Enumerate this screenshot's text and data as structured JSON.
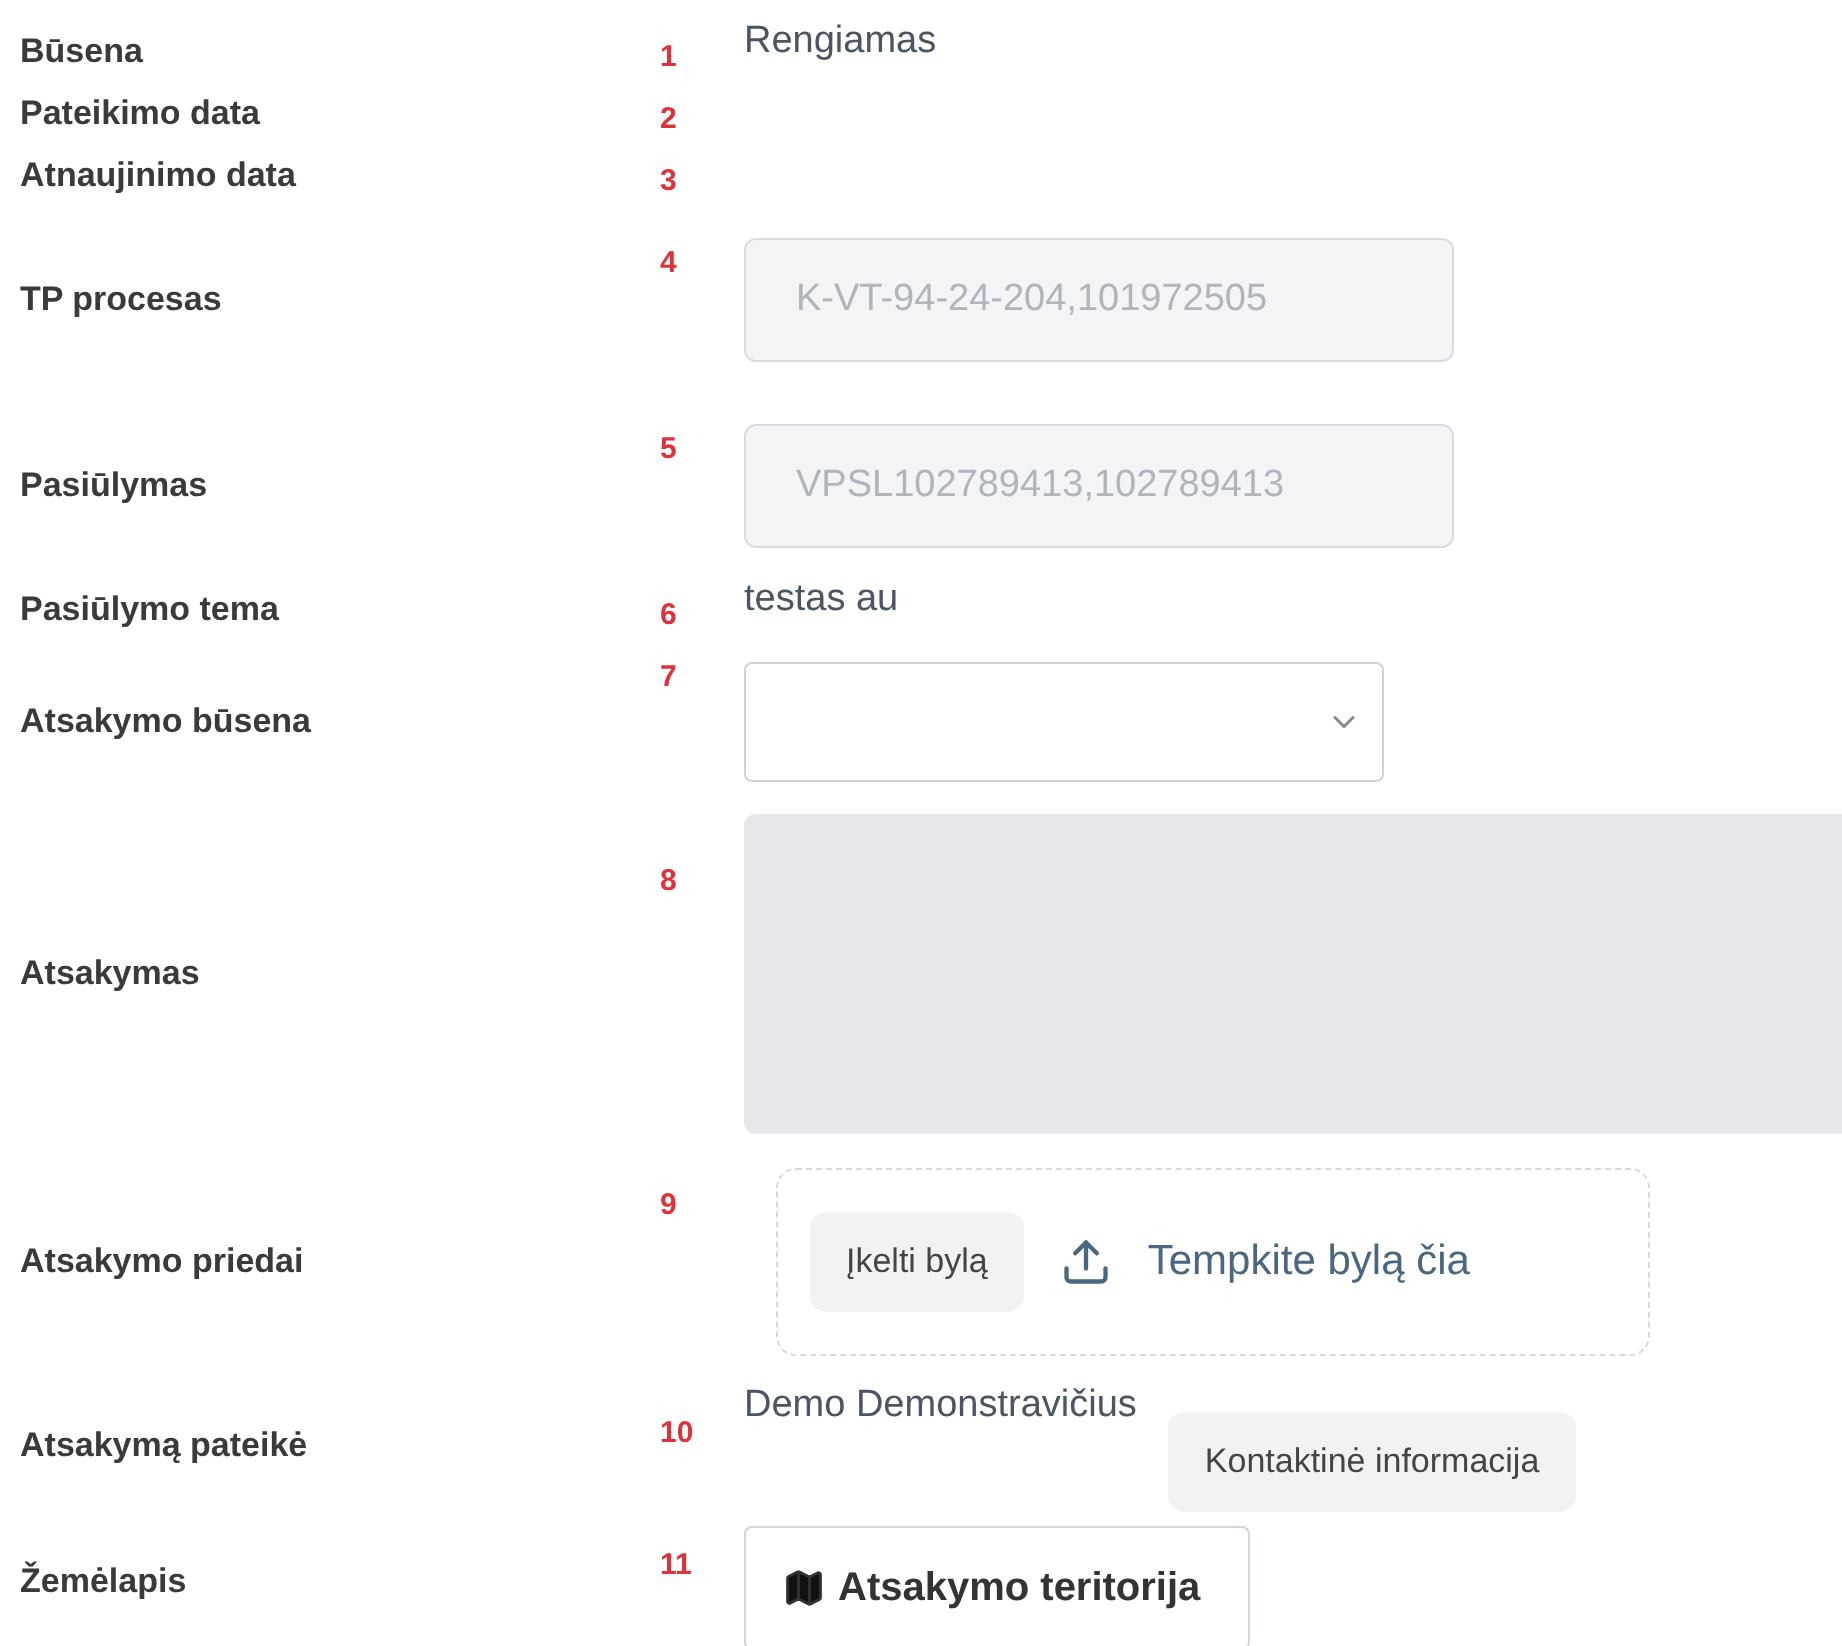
{
  "fields": [
    {
      "kind": "text",
      "label": "Būsena",
      "number": "1",
      "value": "Rengiamas"
    },
    {
      "kind": "text",
      "label": "Pateikimo data",
      "number": "2"
    },
    {
      "kind": "text",
      "label": "Atnaujinimo data",
      "number": "3"
    },
    {
      "kind": "input",
      "label": "TP procesas",
      "number": "4",
      "value": "K-VT-94-24-204,101972505",
      "disabled": true
    },
    {
      "kind": "input",
      "label": "Pasiūlymas",
      "number": "5",
      "value": "VPSL102789413,102789413",
      "disabled": true
    },
    {
      "kind": "text",
      "label": "Pasiūlymo tema",
      "number": "6",
      "value": "testas au"
    },
    {
      "kind": "select",
      "label": "Atsakymo būsena",
      "number": "7"
    },
    {
      "kind": "textarea",
      "label": "Atsakymas",
      "number": "8",
      "disabled": true
    },
    {
      "kind": "upload",
      "label": "Atsakymo priedai",
      "number": "9",
      "button": "Įkelti bylą",
      "hint": "Tempkite bylą čia"
    },
    {
      "kind": "person",
      "label": "Atsakymą pateikė",
      "number": "10",
      "value": "Demo Demonstravičius",
      "button": "Kontaktinė informacija"
    },
    {
      "kind": "map",
      "label": "Žemėlapis",
      "number": "11",
      "button": "Atsakymo teritorija"
    }
  ]
}
